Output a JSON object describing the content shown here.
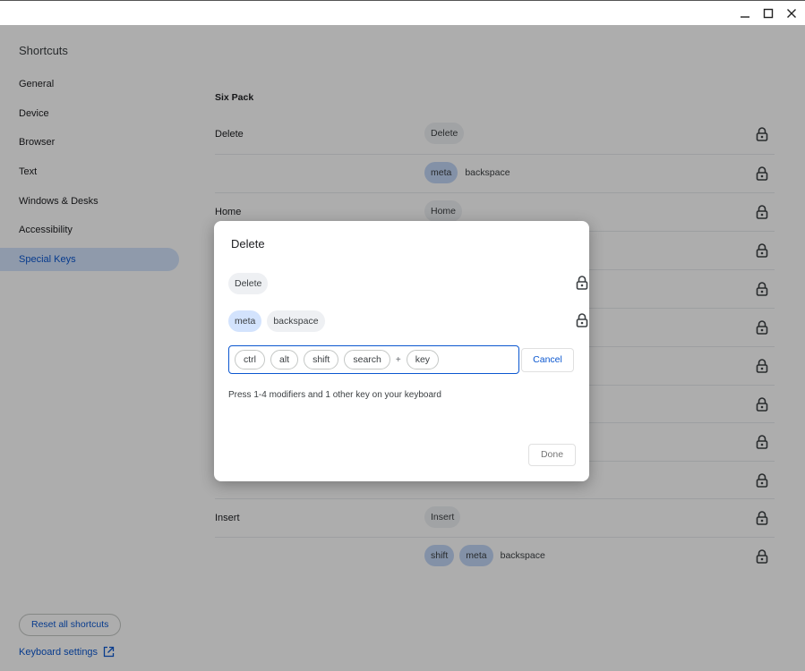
{
  "window": {
    "minimize": "—",
    "maximize": "☐",
    "close": "✕"
  },
  "sidebar": {
    "title": "Shortcuts",
    "items": [
      {
        "label": "General"
      },
      {
        "label": "Device"
      },
      {
        "label": "Browser"
      },
      {
        "label": "Text"
      },
      {
        "label": "Windows & Desks"
      },
      {
        "label": "Accessibility"
      },
      {
        "label": "Special Keys",
        "active": true
      }
    ],
    "reset_label": "Reset all shortcuts",
    "keyboard_settings_label": "Keyboard settings"
  },
  "main": {
    "section_title": "Six Pack",
    "rows": [
      {
        "name": "Delete",
        "keys": [
          "Delete"
        ]
      },
      {
        "name": "",
        "keys": [
          "meta",
          "backspace"
        ]
      },
      {
        "name": "Home",
        "keys": [
          "Home"
        ]
      },
      {
        "name": "Insert",
        "keys": [
          "Insert"
        ]
      },
      {
        "name": "",
        "keys": [
          "shift",
          "meta",
          "backspace"
        ]
      }
    ]
  },
  "dialog": {
    "title": "Delete",
    "accelerators": [
      {
        "keys": [
          "Delete"
        ]
      },
      {
        "keys": [
          "meta",
          "backspace"
        ]
      }
    ],
    "editor": {
      "modifiers": [
        "ctrl",
        "alt",
        "shift",
        "search"
      ],
      "plus": "+",
      "key": "key"
    },
    "cancel_label": "Cancel",
    "hint": "Press 1-4 modifiers and 1 other key on your keyboard",
    "done_label": "Done"
  },
  "colors": {
    "accent": "#0b57d0",
    "active_nav_bg": "#d3e3fd",
    "modifier_chip": "#d3e3fd"
  }
}
